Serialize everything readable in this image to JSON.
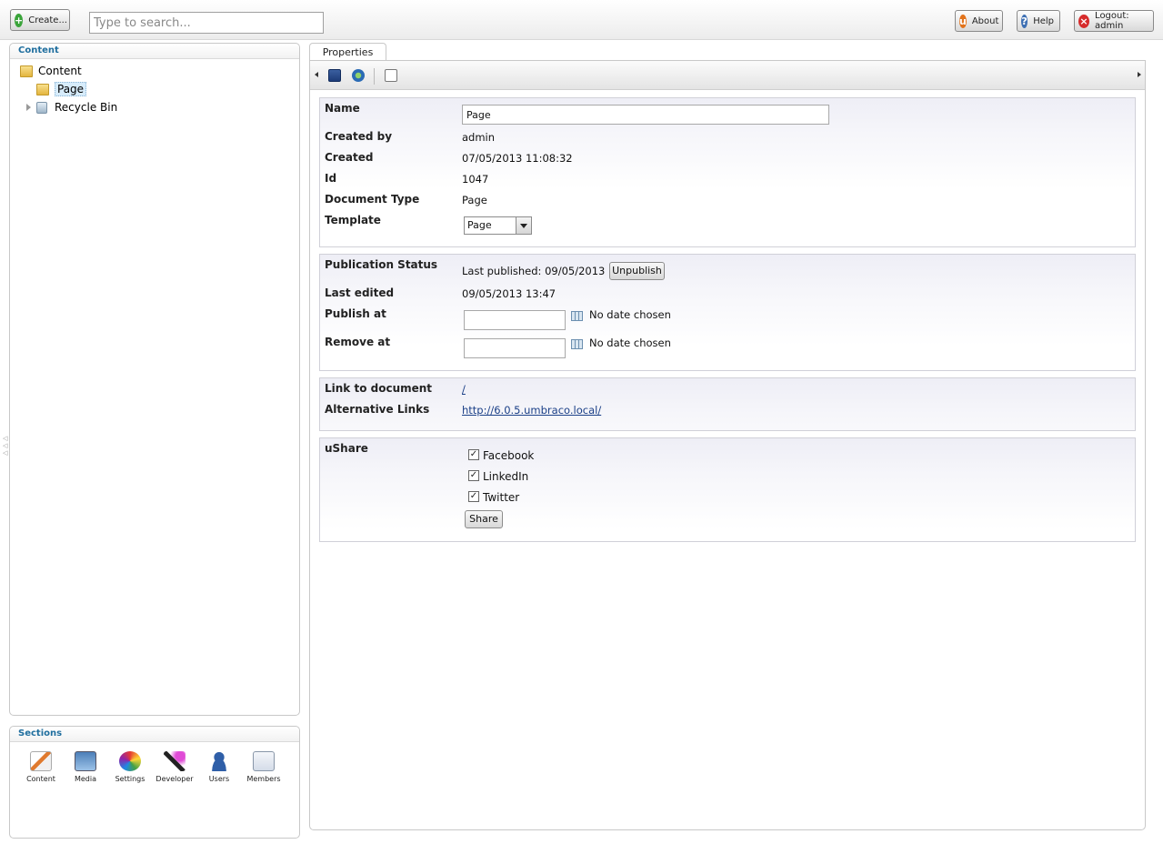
{
  "header": {
    "create_label": "Create...",
    "search_placeholder": "Type to search...",
    "about_label": "About",
    "help_label": "Help",
    "logout_label": "Logout: admin"
  },
  "content_panel": {
    "title": "Content",
    "tree": {
      "root_label": "Content",
      "page_label": "Page",
      "recycle_label": "Recycle Bin"
    }
  },
  "sections_panel": {
    "title": "Sections",
    "items": [
      "Content",
      "Media",
      "Settings",
      "Developer",
      "Users",
      "Members"
    ]
  },
  "tabs": {
    "properties": "Properties"
  },
  "properties": {
    "name_label": "Name",
    "name_value": "Page",
    "created_by_label": "Created by",
    "created_by_value": "admin",
    "created_label": "Created",
    "created_value": "07/05/2013 11:08:32",
    "id_label": "Id",
    "id_value": "1047",
    "doctype_label": "Document Type",
    "doctype_value": "Page",
    "template_label": "Template",
    "template_value": "Page"
  },
  "publication": {
    "status_label": "Publication Status",
    "status_value": "Last published: 09/05/2013",
    "unpublish_label": "Unpublish",
    "last_edited_label": "Last edited",
    "last_edited_value": "09/05/2013 13:47",
    "publish_at_label": "Publish at",
    "publish_at_note": "No date chosen",
    "remove_at_label": "Remove at",
    "remove_at_note": "No date chosen"
  },
  "links": {
    "link_label": "Link to document",
    "link_value": "/",
    "alt_label": "Alternative Links",
    "alt_value": "http://6.0.5.umbraco.local/"
  },
  "ushare": {
    "label": "uShare",
    "options": [
      "Facebook",
      "LinkedIn",
      "Twitter"
    ],
    "share_label": "Share"
  },
  "colors": {
    "accent": "#1f6e9e",
    "link": "#1a3f87",
    "about_icon": "#e2731b",
    "help_icon": "#3d6fb3",
    "logout_icon": "#d62b2b",
    "create_icon": "#3aa43a"
  }
}
